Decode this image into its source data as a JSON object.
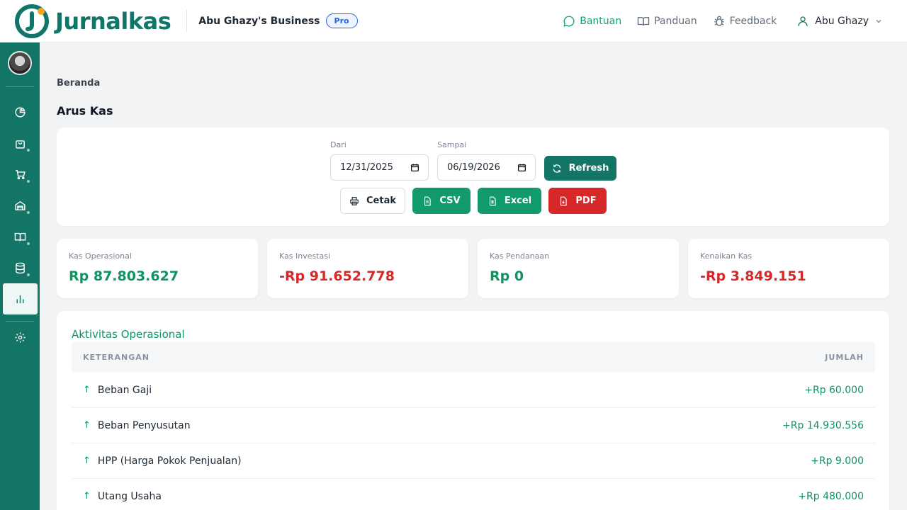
{
  "header": {
    "brand": "Jurnalkas",
    "business_name": "Abu Ghazy's Business",
    "plan_badge": "Pro",
    "nav": {
      "help": "Bantuan",
      "guide": "Panduan",
      "feedback": "Feedback"
    },
    "user_name": "Abu Ghazy"
  },
  "breadcrumb": "Beranda",
  "page_title": "Arus Kas",
  "filters": {
    "from_label": "Dari",
    "from_value": "12/31/2025",
    "to_label": "Sampai",
    "to_value": "06/19/2026",
    "refresh_label": "Refresh",
    "print_label": "Cetak",
    "csv_label": "CSV",
    "excel_label": "Excel",
    "pdf_label": "PDF"
  },
  "stats": [
    {
      "label": "Kas Operasional",
      "value": "Rp 87.803.627",
      "tone": "positive"
    },
    {
      "label": "Kas Investasi",
      "value": "-Rp 91.652.778",
      "tone": "negative"
    },
    {
      "label": "Kas Pendanaan",
      "value": "Rp 0",
      "tone": "positive"
    },
    {
      "label": "Kenaikan Kas",
      "value": "-Rp 3.849.151",
      "tone": "negative"
    }
  ],
  "operational": {
    "title": "Aktivitas Operasional",
    "col_desc": "KETERANGAN",
    "col_amount": "JUMLAH",
    "rows": [
      {
        "arrow": "↑",
        "desc": "Beban Gaji",
        "amount": "+Rp 60.000"
      },
      {
        "arrow": "↑",
        "desc": "Beban Penyusutan",
        "amount": "+Rp 14.930.556"
      },
      {
        "arrow": "↑",
        "desc": "HPP (Harga Pokok Penjualan)",
        "amount": "+Rp 9.000"
      },
      {
        "arrow": "↑",
        "desc": "Utang Usaha",
        "amount": "+Rp 480.000"
      }
    ]
  },
  "colors": {
    "brand": "#137566",
    "positive": "#0f9461",
    "negative": "#d62828",
    "pro_badge": "#2563eb"
  }
}
